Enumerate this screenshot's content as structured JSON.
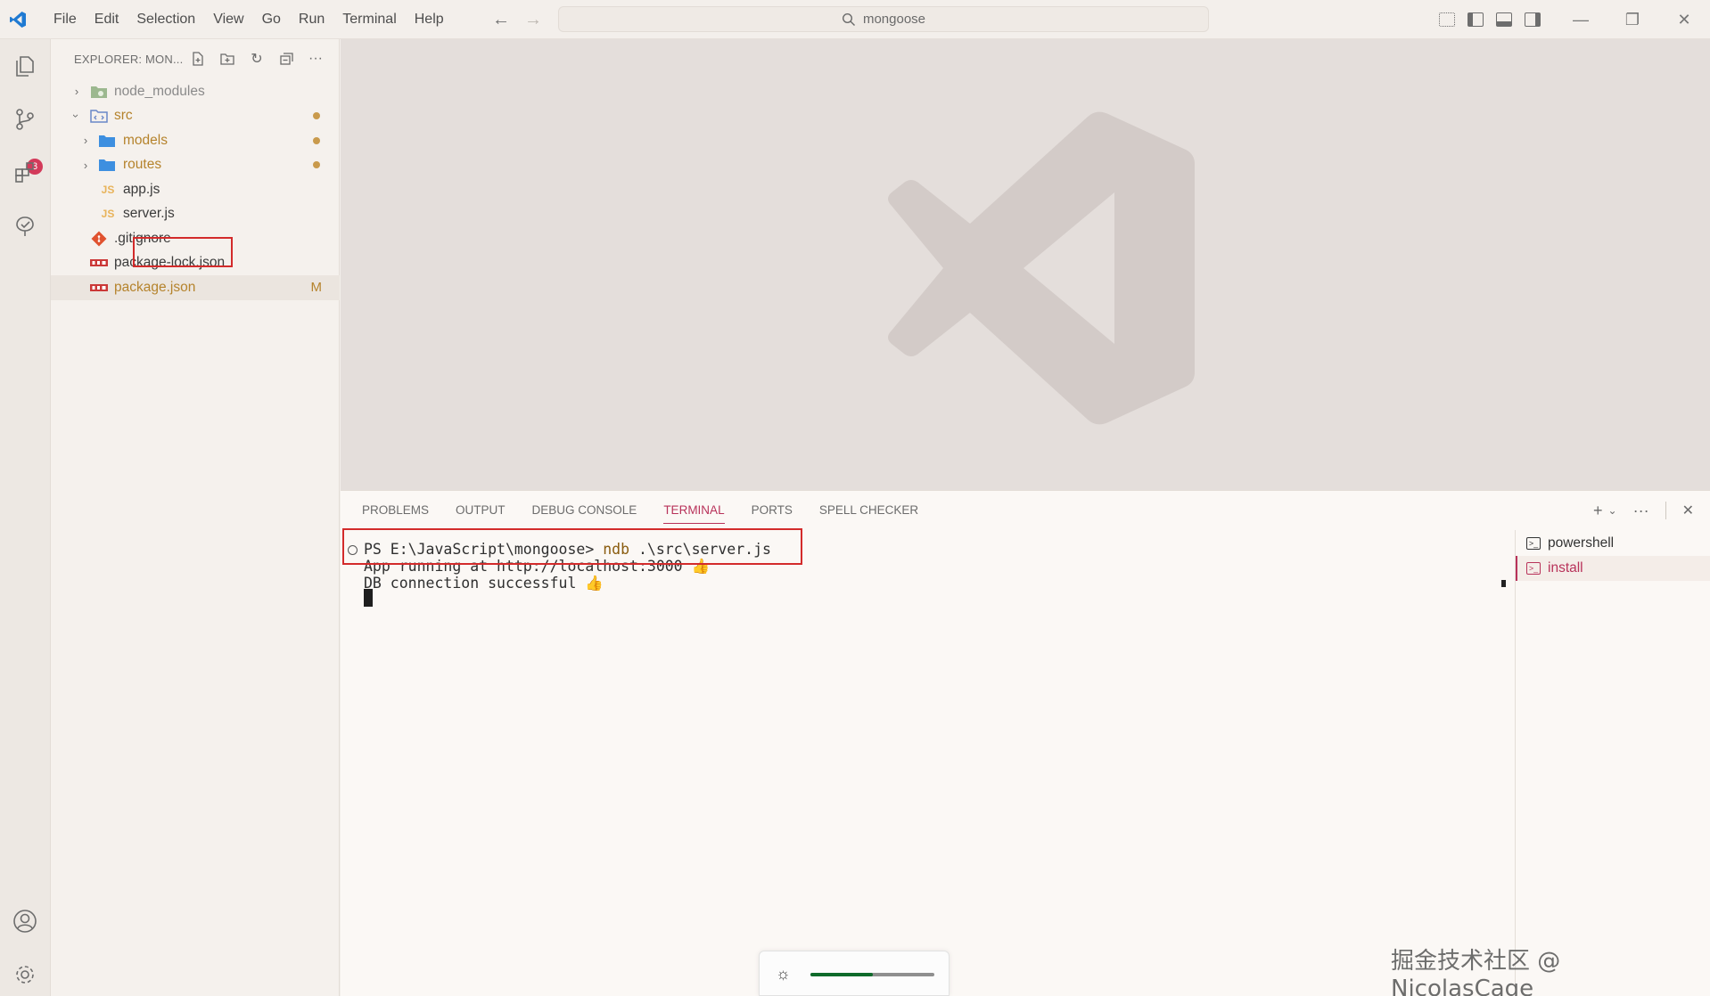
{
  "menu": [
    "File",
    "Edit",
    "Selection",
    "View",
    "Go",
    "Run",
    "Terminal",
    "Help"
  ],
  "search": {
    "text": "mongoose"
  },
  "activity": {
    "source_control_badge": "3"
  },
  "sidebar": {
    "title": "EXPLORER: MON...",
    "tree": [
      {
        "label": "node_modules",
        "type": "folder",
        "depth": 0,
        "expanded": false,
        "color": "#8a8a8a"
      },
      {
        "label": "src",
        "type": "folder",
        "depth": 0,
        "expanded": true,
        "color": "#b5832c",
        "dot": true
      },
      {
        "label": "models",
        "type": "folder",
        "depth": 1,
        "expanded": false,
        "color": "#b5832c",
        "dot": true
      },
      {
        "label": "routes",
        "type": "folder",
        "depth": 1,
        "expanded": false,
        "color": "#b5832c",
        "dot": true
      },
      {
        "label": "app.js",
        "type": "js",
        "depth": 1,
        "color": "#3b3b3b"
      },
      {
        "label": "server.js",
        "type": "js",
        "depth": 1,
        "color": "#3b3b3b"
      },
      {
        "label": ".gitignore",
        "type": "git",
        "depth": 0,
        "color": "#3b3b3b"
      },
      {
        "label": "package-lock.json",
        "type": "npm",
        "depth": 0,
        "color": "#3b3b3b"
      },
      {
        "label": "package.json",
        "type": "npm",
        "depth": 0,
        "color": "#b5832c",
        "status": "M",
        "selected": true
      }
    ]
  },
  "panel": {
    "tabs": [
      "PROBLEMS",
      "OUTPUT",
      "DEBUG CONSOLE",
      "TERMINAL",
      "PORTS",
      "SPELL CHECKER"
    ],
    "active_tab": "TERMINAL"
  },
  "terminal": {
    "prompt": "PS E:\\JavaScript\\mongoose> ",
    "command": "ndb",
    "args": " .\\src\\server.js",
    "output": [
      "App running at http://localhost:3000 👍",
      "DB connection successful 👍"
    ],
    "sessions": [
      {
        "name": "powershell",
        "active": false
      },
      {
        "name": "install",
        "active": true
      }
    ]
  },
  "brightness": {
    "level": 0.5
  },
  "credit": "掘金技术社区 @ NicolasCage",
  "colors": {
    "accent": "#b8325a",
    "highlight_box": "#d32b2b",
    "modified": "#b5832c"
  }
}
